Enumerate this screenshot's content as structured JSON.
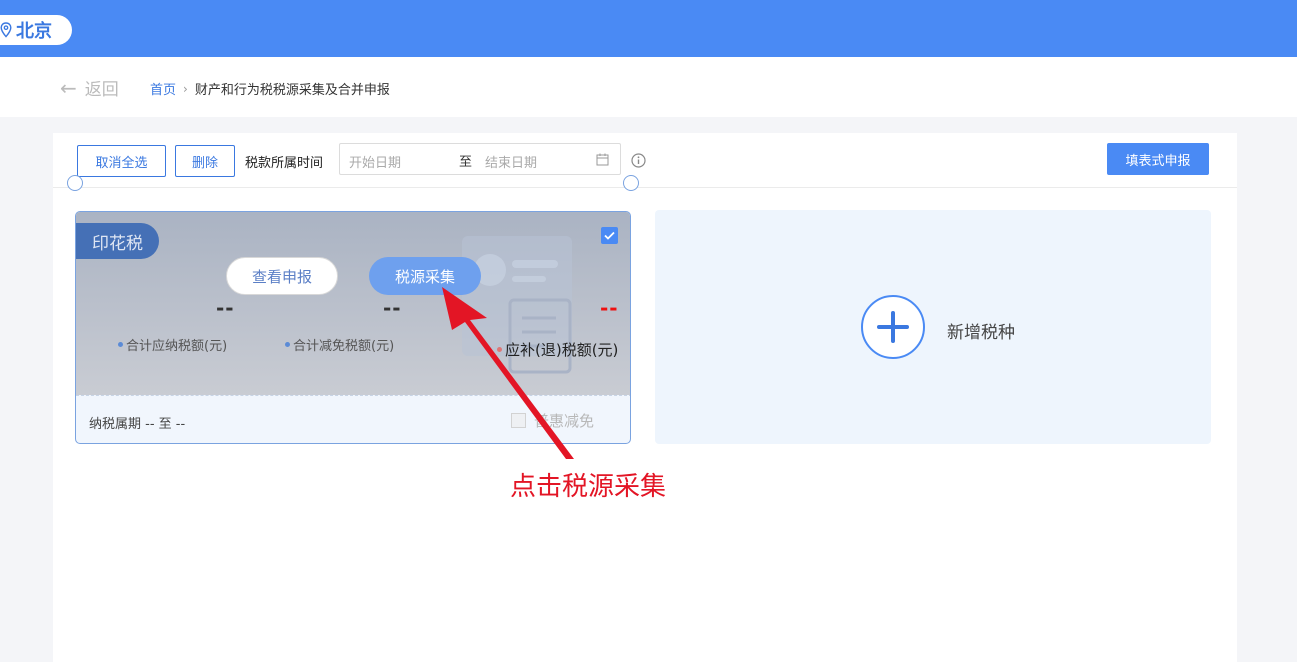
{
  "header": {
    "city": "北京",
    "icons": {
      "location": "location-pin-icon"
    }
  },
  "nav": {
    "back_label": "返回",
    "breadcrumb_home": "首页",
    "breadcrumb_current": "财产和行为税税源采集及合并申报"
  },
  "toolbar": {
    "deselect_all_label": "取消全选",
    "delete_label": "删除",
    "tax_period_label": "税款所属时间",
    "start_date_placeholder": "开始日期",
    "to_label": "至",
    "end_date_placeholder": "结束日期",
    "fill_form_label": "填表式申报"
  },
  "tax_card": {
    "name": "印花税",
    "checked": true,
    "view_button": "查看申报",
    "collect_button": "税源采集",
    "payable_value": "--",
    "payable_label": "合计应纳税额(元)",
    "reduction_value": "--",
    "reduction_label": "合计减免税额(元)",
    "refund_value": "--",
    "refund_label": "应补(退)税额(元)",
    "period_label": "纳税属期",
    "period_value": "-- 至 --",
    "benefit_label": "普惠减免"
  },
  "add_card": {
    "label": "新增税种"
  },
  "annotation": {
    "text": "点击税源采集",
    "color": "#e31525"
  },
  "colors": {
    "brand": "#4a8af4",
    "link": "#3a78e0"
  }
}
